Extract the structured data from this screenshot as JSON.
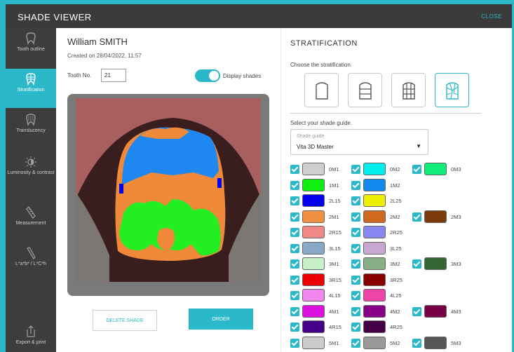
{
  "app": {
    "title": "SHADE VIEWER",
    "close_label": "CLOSE"
  },
  "sidebar": {
    "items": [
      {
        "label": "Tooth outline",
        "icon": "tooth-icon"
      },
      {
        "label": "Stratification",
        "icon": "stratification-icon"
      },
      {
        "label": "Translucency",
        "icon": "translucency-icon"
      },
      {
        "label": "Luminosity & contrast",
        "icon": "luminosity-icon"
      },
      {
        "label": "Measurement",
        "icon": "measurement-icon"
      },
      {
        "label": "L*a*b* / L*C*h",
        "icon": "color-probe-icon"
      },
      {
        "label": "Export & print",
        "icon": "export-icon"
      }
    ],
    "active": "Stratification"
  },
  "patient": {
    "name": "William SMITH",
    "created": "Created on 28/04/2022, 11:57",
    "tooth_label": "Tooth No.",
    "tooth_no": "21",
    "display_shades_label": "Display shades",
    "display_shades_on": true
  },
  "buttons": {
    "delete": "DELETE SHADE",
    "order": "ORDER"
  },
  "stratification": {
    "title": "STRATIFICATION",
    "choose_label": "Choose the stratification.",
    "options": [
      "single-layer",
      "three-horizontal",
      "grid",
      "mosaic"
    ],
    "selected": "mosaic",
    "select_guide_label": "Select your shade guide.",
    "guide_placeholder": "Shade guide",
    "guide_value": "Vita 3D Master"
  },
  "shades": [
    {
      "code": "0M1",
      "color": "#cfcfcf"
    },
    {
      "code": "0M2",
      "color": "#00eeee"
    },
    {
      "code": "0M3",
      "color": "#11ee77"
    },
    {
      "code": "1M1",
      "color": "#11ee11"
    },
    {
      "code": "1M2",
      "color": "#1188ee"
    },
    {
      "code": "2L15",
      "color": "#0000ee"
    },
    {
      "code": "2L25",
      "color": "#eeee00"
    },
    {
      "code": "2M1",
      "color": "#f09040"
    },
    {
      "code": "2M2",
      "color": "#d06820"
    },
    {
      "code": "2M3",
      "color": "#7a3a0a"
    },
    {
      "code": "2R15",
      "color": "#f08888"
    },
    {
      "code": "2R25",
      "color": "#8888f0"
    },
    {
      "code": "3L15",
      "color": "#88a8c8"
    },
    {
      "code": "3L25",
      "color": "#c8a8d0"
    },
    {
      "code": "3M1",
      "color": "#c8f0c8"
    },
    {
      "code": "3M2",
      "color": "#88b088"
    },
    {
      "code": "3M3",
      "color": "#336633"
    },
    {
      "code": "3R15",
      "color": "#ee0000"
    },
    {
      "code": "3R25",
      "color": "#880000"
    },
    {
      "code": "4L15",
      "color": "#f088f0"
    },
    {
      "code": "4L25",
      "color": "#ee44aa"
    },
    {
      "code": "4M1",
      "color": "#dd11dd"
    },
    {
      "code": "4M2",
      "color": "#880088"
    },
    {
      "code": "4M3",
      "color": "#770044"
    },
    {
      "code": "4R15",
      "color": "#440088"
    },
    {
      "code": "4R25",
      "color": "#440044"
    },
    {
      "code": "5M1",
      "color": "#cccccc"
    },
    {
      "code": "5M2",
      "color": "#999999"
    },
    {
      "code": "5M3",
      "color": "#555555"
    }
  ]
}
